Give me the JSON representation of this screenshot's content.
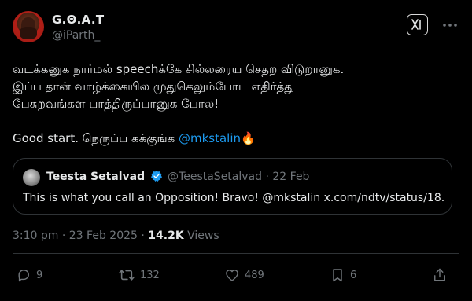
{
  "author": {
    "display_name": "G.Θ.A.T",
    "handle": "@iParth_",
    "avatar_icon": "profile-avatar-icon"
  },
  "header_icons": {
    "app_badge": "app-badge-icon",
    "more": "more-options-icon"
  },
  "tweet": {
    "line1": "வடக்கனுக நார்மல் speechக்கே சில்லரைய செதற விடுறானுக.",
    "line2": "இப்ப தான் வாழ்க்கையில முதுகெலும்போட எதிர்த்து",
    "line3": "பேசுறவங்கள பாத்திருப்பானுக போல!",
    "line4_prefix": "Good start. நெருப்ப கக்குங்க ",
    "mention": "@mkstalin",
    "emoji": "🔥"
  },
  "quote": {
    "name": "Teesta Setalvad",
    "handle": "@TeestaSetalvad",
    "separator": "·",
    "date": "22 Feb",
    "text": "This is what you call an Opposition! Bravo! @mkstalin x.com/ndtv/status/18..."
  },
  "meta": {
    "time": "3:10 pm",
    "separator": "·",
    "date": "23 Feb 2025",
    "views_count": "14.2K",
    "views_label": "Views"
  },
  "actions": {
    "replies": "9",
    "reposts": "132",
    "likes": "489",
    "bookmarks": "6"
  },
  "colors": {
    "background": "#000000",
    "text": "#e7e9ea",
    "secondary": "#71767b",
    "link": "#1d9bf0",
    "border": "#2f3336"
  }
}
